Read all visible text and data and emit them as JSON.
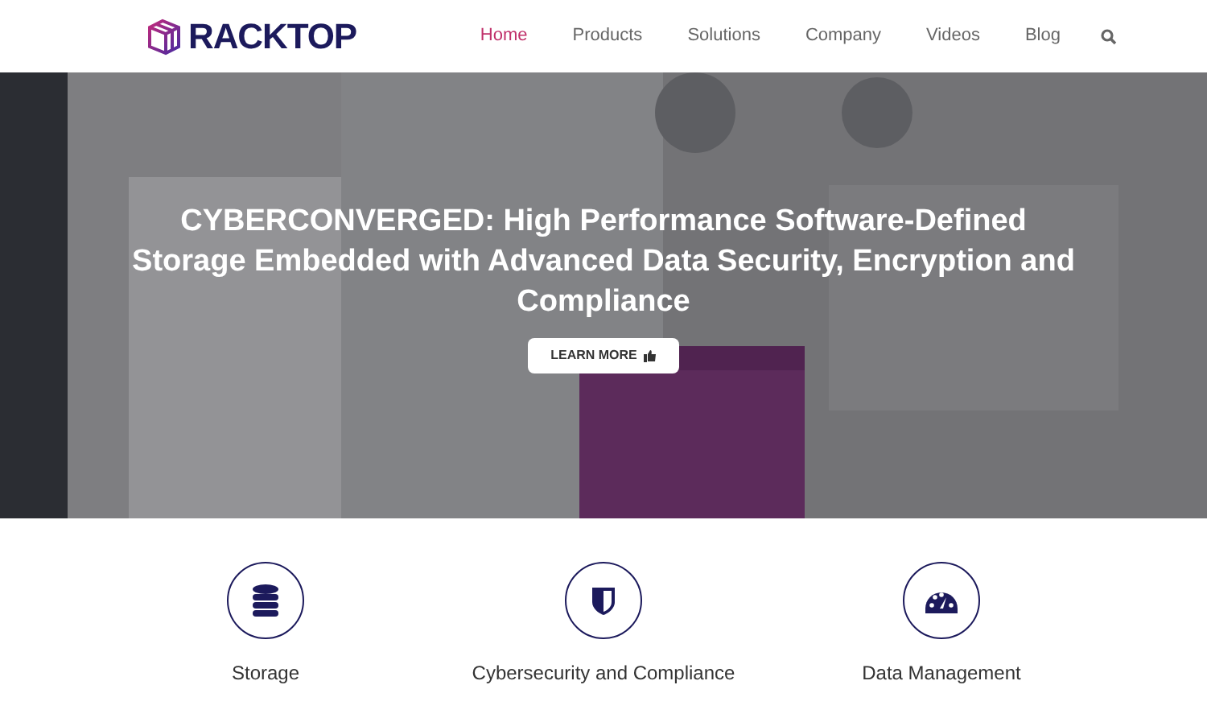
{
  "header": {
    "logo": "RACKTOP",
    "nav": [
      {
        "label": "Home",
        "selected": true
      },
      {
        "label": "Products",
        "selected": false
      },
      {
        "label": "Solutions",
        "selected": false
      },
      {
        "label": "Company",
        "selected": false
      },
      {
        "label": "Videos",
        "selected": false
      },
      {
        "label": "Blog",
        "selected": false
      }
    ]
  },
  "hero": {
    "headline": "CYBERCONVERGED: High Performance Software-Defined Storage Embedded with Advanced Data Security, Encryption and Compliance",
    "button": "LEARN MORE"
  },
  "features": [
    {
      "kind": "storage",
      "label": "Storage"
    },
    {
      "kind": "shield",
      "label": "Cybersecurity and Compliance"
    },
    {
      "kind": "gauge",
      "label": "Data Management"
    }
  ]
}
